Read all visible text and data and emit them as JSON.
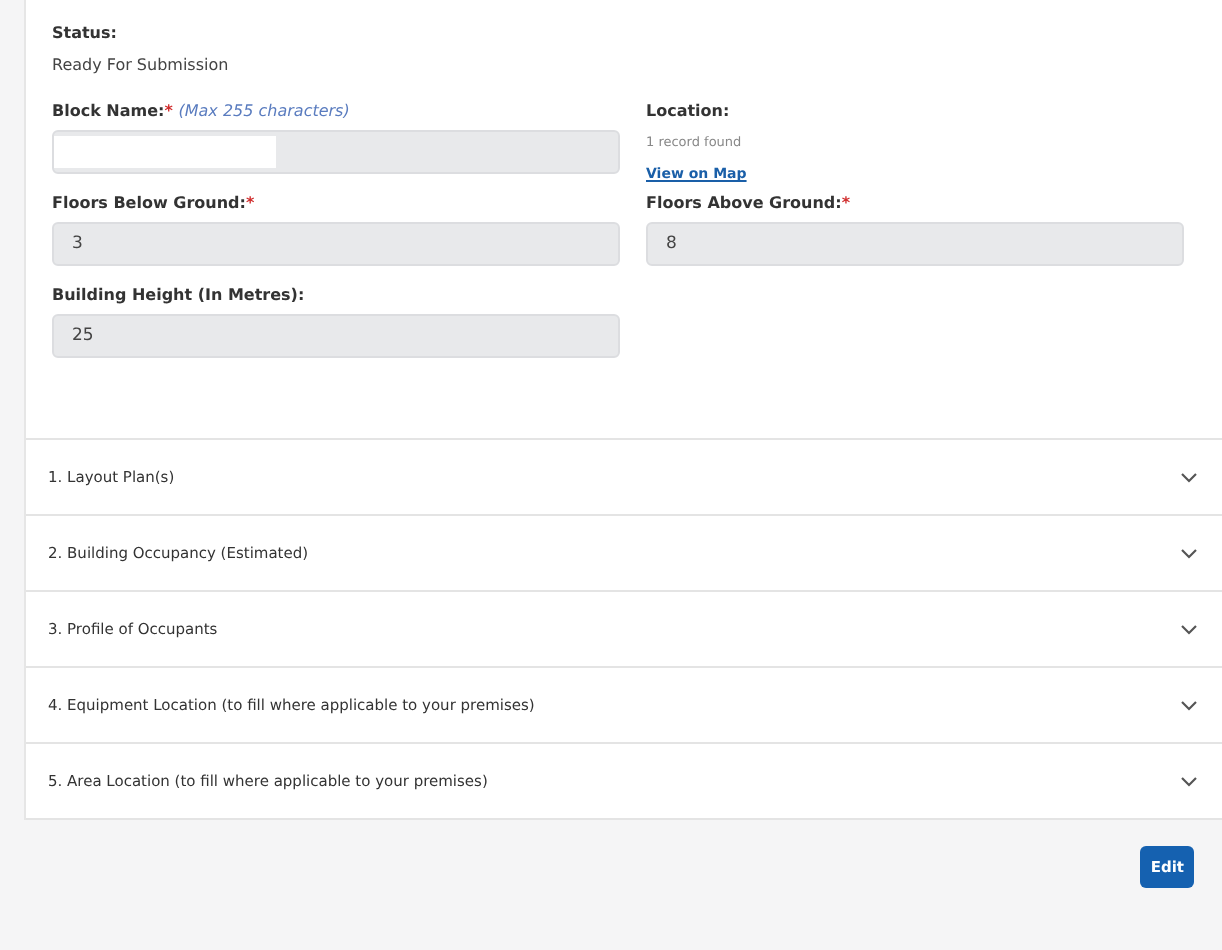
{
  "status": {
    "label": "Status:",
    "value": "Ready For Submission"
  },
  "block_name": {
    "label": "Block Name:",
    "required_mark": "*",
    "hint": "(Max 255 characters)"
  },
  "location": {
    "label": "Location:",
    "result": "1 record found",
    "link": "View on Map"
  },
  "floors_below": {
    "label": "Floors Below Ground:",
    "required_mark": "*",
    "value": "3"
  },
  "floors_above": {
    "label": "Floors Above Ground:",
    "required_mark": "*",
    "value": "8"
  },
  "building_height": {
    "label": "Building Height (In Metres):",
    "value": "25"
  },
  "sections": [
    {
      "title": "1. Layout Plan(s)",
      "expanded": false
    },
    {
      "title": "2. Building Occupancy (Estimated)",
      "expanded": false
    },
    {
      "title": "3. Profile of Occupants",
      "expanded": false
    },
    {
      "title": "4. Equipment Location (to fill where applicable to your premises)",
      "expanded": false
    },
    {
      "title": "5. Area Location (to fill where applicable to your premises)",
      "expanded": false
    }
  ],
  "buttons": [
    "Edit"
  ]
}
